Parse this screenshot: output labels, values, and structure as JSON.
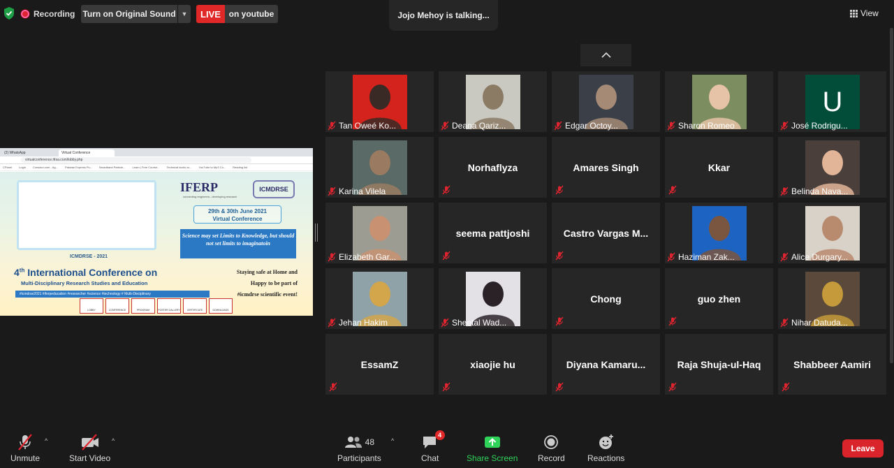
{
  "topbar": {
    "recording": "Recording",
    "original_sound": "Turn on Original Sound",
    "live": "LIVE",
    "live_platform": "on youtube",
    "talking": "Jojo Mehoy is talking...",
    "view": "View"
  },
  "shared_screen": {
    "tabs": [
      "(2) WhatsApp",
      "Virtual Conference"
    ],
    "url": "virtualconference.ifrsa.com/lobby.php",
    "bookmarks": [
      "CPanel",
      "Login",
      "Consaco.com - Ag...",
      "Pakwan Express Pu...",
      "Broadband Particle...",
      "Learn | Free Course...",
      "Technical taolio co...",
      "YouTube to Mp3 Co...",
      "Reading list"
    ],
    "logo": "IFERP",
    "logo_tagline": "connecting engineers...developing research",
    "logo2": "ICMDRSE",
    "date_line1": "29th & 30th June 2021",
    "date_line2": "Virtual Conference",
    "quote": "Science may set Limits to Knowledge, but should not set limits to imaginatoin",
    "frame_tag": "ICMDRSE - 2021",
    "title_pre": "4",
    "title_sup": "th",
    "title_post": " International Conference on",
    "subtitle": "Multi-Disciplinary Research Studies and Education",
    "hashtags": "#icmdrse2021 #iferpeducation #researcher #science #technology # Multi-Disciplinary",
    "right_text_1": "Staying safe at Home and",
    "right_text_2": "Happy to be part of",
    "right_text_3": "#icmdrse scientific event!",
    "buttons": [
      "LOBBY",
      "CONFERENCE",
      "PROGRAM",
      "POSTER GALLERY",
      "CERTIFICATE",
      "DOWNLOADS"
    ]
  },
  "participants": [
    {
      "name": "Tan Oweé Ko...",
      "video": true,
      "photo_bg": "#d3231c",
      "photo_fg": "#3a2a26"
    },
    {
      "name": "Deana Qariz...",
      "video": true,
      "photo_bg": "#c9c9c2",
      "photo_fg": "#8b7a64"
    },
    {
      "name": "Edgar Octoy...",
      "video": true,
      "photo_bg": "#3b3f47",
      "photo_fg": "#a58a76"
    },
    {
      "name": "Sharon Romeo",
      "video": true,
      "photo_bg": "#7c8d5f",
      "photo_fg": "#e6c3a7"
    },
    {
      "name": "José Rodrigu...",
      "video": true,
      "avatar_letter": "U",
      "photo_bg": "#024d3a"
    },
    {
      "name": "Karina Vilela",
      "video": true,
      "photo_bg": "#5a6a66",
      "photo_fg": "#9a7b61"
    },
    {
      "name": "Norhaflyza",
      "video": false
    },
    {
      "name": "Amares Singh",
      "video": false
    },
    {
      "name": "Kkar",
      "video": false
    },
    {
      "name": "Belinda Nava...",
      "video": true,
      "photo_bg": "#4b3f3c",
      "photo_fg": "#e2b598"
    },
    {
      "name": "Elizabeth Gar...",
      "video": true,
      "photo_bg": "#9c9c92",
      "photo_fg": "#c89272"
    },
    {
      "name": "seema pattjoshi",
      "video": false
    },
    {
      "name": "Castro Vargas M...",
      "video": false
    },
    {
      "name": "Haziman Zak...",
      "video": true,
      "photo_bg": "#1d63c2",
      "photo_fg": "#7a5540"
    },
    {
      "name": "Alice Durgary...",
      "video": true,
      "photo_bg": "#d9d2c9",
      "photo_fg": "#b88a6e"
    },
    {
      "name": "Jehan Hakim",
      "video": true,
      "photo_bg": "#8ea2a8",
      "photo_fg": "#d4a64b"
    },
    {
      "name": "Sheetal Wad...",
      "video": true,
      "photo_bg": "#e3e1e6",
      "photo_fg": "#2a2226"
    },
    {
      "name": "Chong",
      "video": false
    },
    {
      "name": "guo zhen",
      "video": false
    },
    {
      "name": "Nihar Datuda...",
      "video": true,
      "photo_bg": "#5b4a3c",
      "photo_fg": "#c59a3a"
    },
    {
      "name": "EssamZ",
      "video": false
    },
    {
      "name": "xiaojie hu",
      "video": false
    },
    {
      "name": "Diyana  Kamaru...",
      "video": false
    },
    {
      "name": "Raja Shuja-ul-Haq",
      "video": false
    },
    {
      "name": "Shabbeer Aamiri",
      "video": false
    }
  ],
  "toolbar": {
    "unmute": "Unmute",
    "start_video": "Start Video",
    "participants": "Participants",
    "participants_count": "48",
    "chat": "Chat",
    "chat_badge": "4",
    "share_screen": "Share Screen",
    "record": "Record",
    "reactions": "Reactions",
    "leave": "Leave"
  },
  "colors": {
    "background": "#1a1a1a",
    "tile": "#262626",
    "live": "#e02828",
    "share_green": "#2fd35a",
    "leave_red": "#d9242c",
    "mute_red": "#e0242f"
  }
}
